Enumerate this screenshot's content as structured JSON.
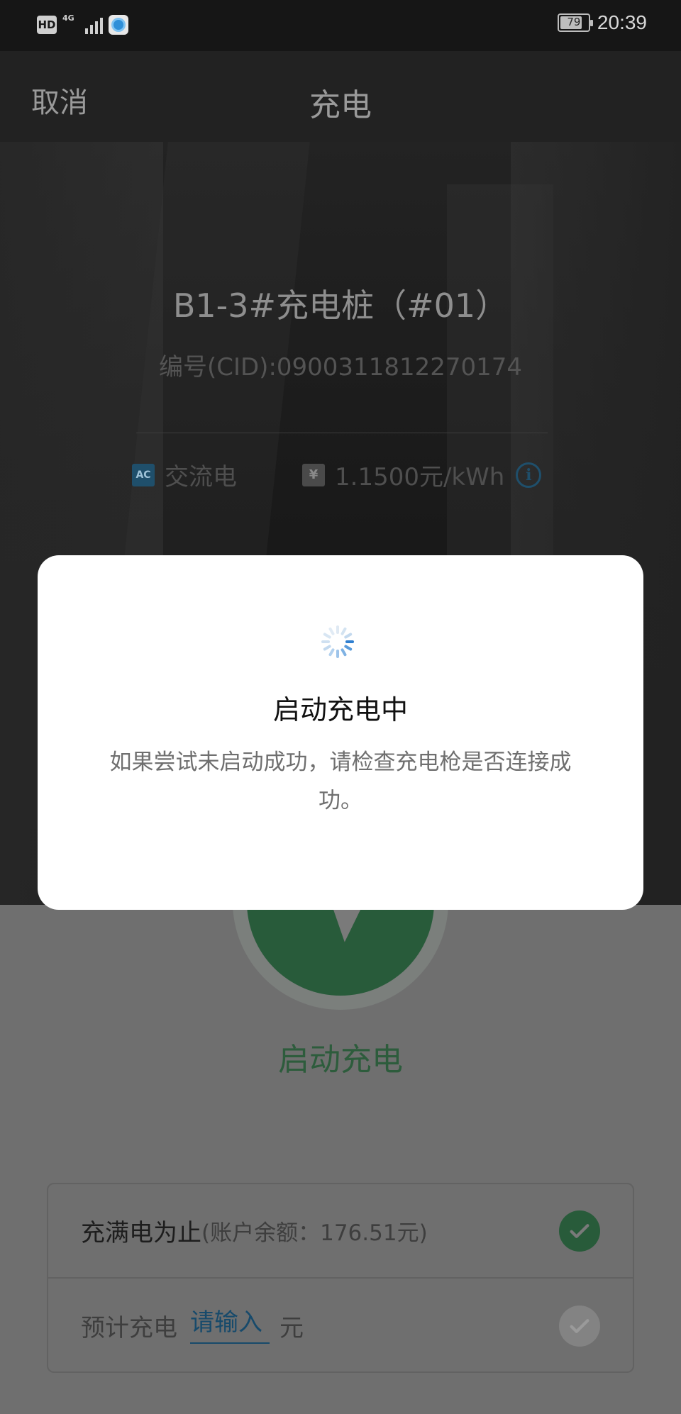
{
  "status_bar": {
    "hd": "HD",
    "network": "4G",
    "battery_level": "79",
    "time": "20:39"
  },
  "nav": {
    "cancel_label": "取消",
    "title": "充电"
  },
  "station": {
    "name": "B1-3#充电桩（#01）",
    "cid": "编号(CID):0900311812270174",
    "ac_tag": "AC",
    "type": "交流电",
    "price_tag": "¥",
    "price": "1.1500元/kWh"
  },
  "start": {
    "label": "启动充电"
  },
  "options": {
    "full_label": "充满电为止",
    "balance": "(账户余额：176.51元)",
    "estimate_label": "预计充电",
    "estimate_placeholder": "请输入",
    "estimate_unit": "元"
  },
  "modal": {
    "title": "启动充电中",
    "message": "如果尝试未启动成功，请检查充电枪是否连接成功。"
  },
  "colors": {
    "accent_green": "#2a9d5c",
    "input_blue": "#1f7fc0"
  }
}
